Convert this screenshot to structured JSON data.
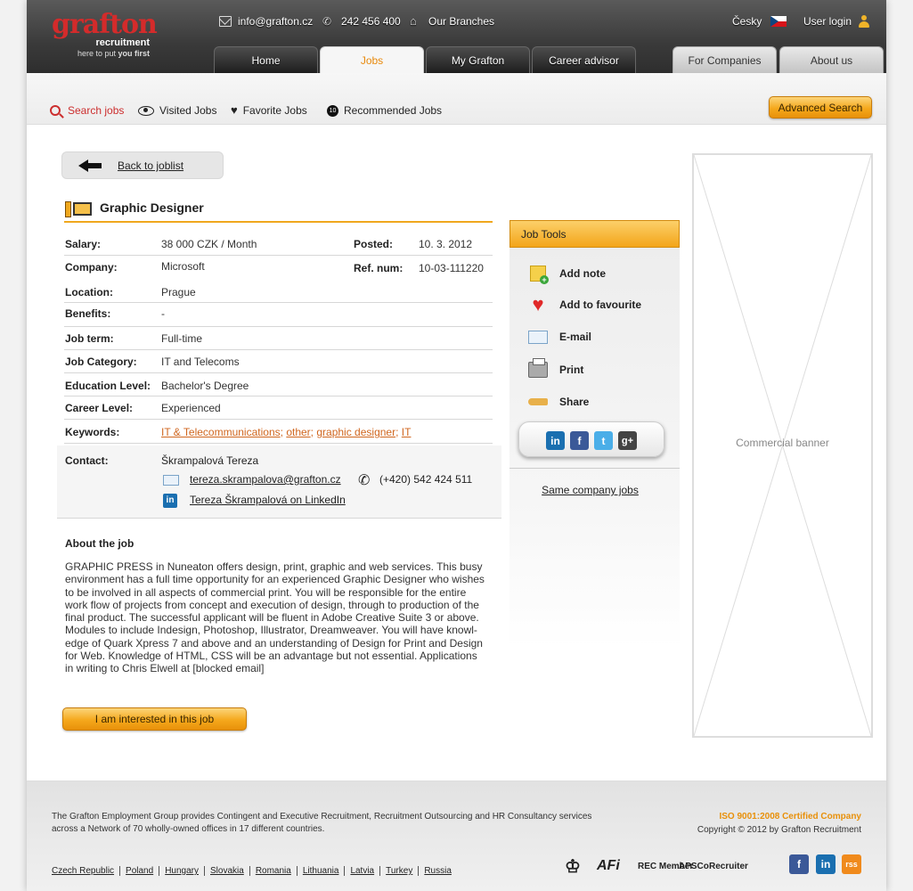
{
  "header": {
    "logo": {
      "name": "grafton",
      "line2": "recruitment",
      "tagline_a": "here to put ",
      "tagline_b": "you first"
    },
    "email": "info@grafton.cz",
    "phone": "242 456 400",
    "branches": "Our Branches",
    "language": "Česky",
    "user_login": "User login",
    "tabs": [
      "Home",
      "Jobs",
      "My Grafton",
      "Career advisor"
    ],
    "right_tabs": [
      "For Companies",
      "About us"
    ],
    "active_tab": "Jobs"
  },
  "subnav": {
    "items": [
      "Search jobs",
      "Visited Jobs",
      "Favorite Jobs",
      "Recommended Jobs"
    ],
    "recommended_count": "10",
    "advanced_search": "Advanced Search"
  },
  "back_label": "Back to joblist",
  "job": {
    "title": "Graphic Designer",
    "salary_label": "Salary:",
    "salary": "38 000 CZK / Month",
    "posted_label": "Posted:",
    "posted": "10. 3. 2012",
    "company_label": "Company:",
    "company": "Microsoft",
    "refnum_label": "Ref. num:",
    "refnum": "10-03-111220",
    "location_label": "Location:",
    "location": "Prague",
    "benefits_label": "Benefits:",
    "benefits": "-",
    "term_label": "Job term:",
    "term": "Full-time",
    "category_label": "Job Category:",
    "category": "IT and Telecoms",
    "education_label": "Education Level:",
    "education": "Bachelor's Degree",
    "career_label": "Career Level:",
    "career": "Experienced",
    "keywords_label": "Keywords:",
    "keywords": [
      "IT & Telecommunications",
      "other",
      "graphic designer",
      "IT"
    ],
    "keyword_sep": ";",
    "contact_label": "Contact:",
    "contact_name": "Škrampalová Tereza",
    "contact_email": "tereza.skrampalova@grafton.cz",
    "contact_phone": "(+420) 542 424 511",
    "contact_linkedin": "Tereza Škrampalová on LinkedIn",
    "about_title": "About the job",
    "about_text": "GRAPHIC PRESS in Nuneaton offers design, print, graphic and web services. This busy environment has a full time opportunity for an experienced Graphic Designer who wishes to be involved in all aspects of commercial print. You will be responsible for the entire work flow of projects from concept and execution of design, through to production of the final product. The successful applicant will be fluent in Adobe Creative Suite 3 or above. Modules to include Indesign, Photoshop, Illustrator, Dreamweaver. You will have knowl-edge of Quark Xpress 7 and above and an understanding of Design for Print and Design for Web. Knowledge of HTML, CSS will be an advantage but not essential. Applications in writing to Chris Elwell at [blocked email]",
    "interested": "I am interested in this job"
  },
  "tools": {
    "title": "Job Tools",
    "items": [
      "Add note",
      "Add to favourite",
      "E-mail",
      "Print",
      "Share"
    ],
    "share_networks": [
      "in",
      "f",
      "t",
      "g+"
    ],
    "same_company": "Same company jobs"
  },
  "banner": "Commercial banner",
  "footer": {
    "description": "The Grafton Employment Group provides Contingent and Executive Recruitment, Recruitment Outsourcing and HR Consultancy services across a Network of 70 wholly-owned offices in 17 different countries.",
    "iso": "ISO 9001:2008 Certified Company",
    "copyright": "Copyright © 2012 by Grafton Recruitment",
    "countries": [
      "Czech Republic",
      "Poland",
      "Hungary",
      "Slovakia",
      "Romania",
      "Lithuania",
      "Latvia",
      "Turkey",
      "Russia"
    ],
    "certs": [
      "APSCo",
      "REC Member",
      "Recruiter"
    ],
    "social": [
      "f",
      "in",
      "rss"
    ]
  },
  "colors": {
    "accent": "#f3a519",
    "brand_red": "#d42b2b",
    "link_orange": "#d0661f"
  }
}
